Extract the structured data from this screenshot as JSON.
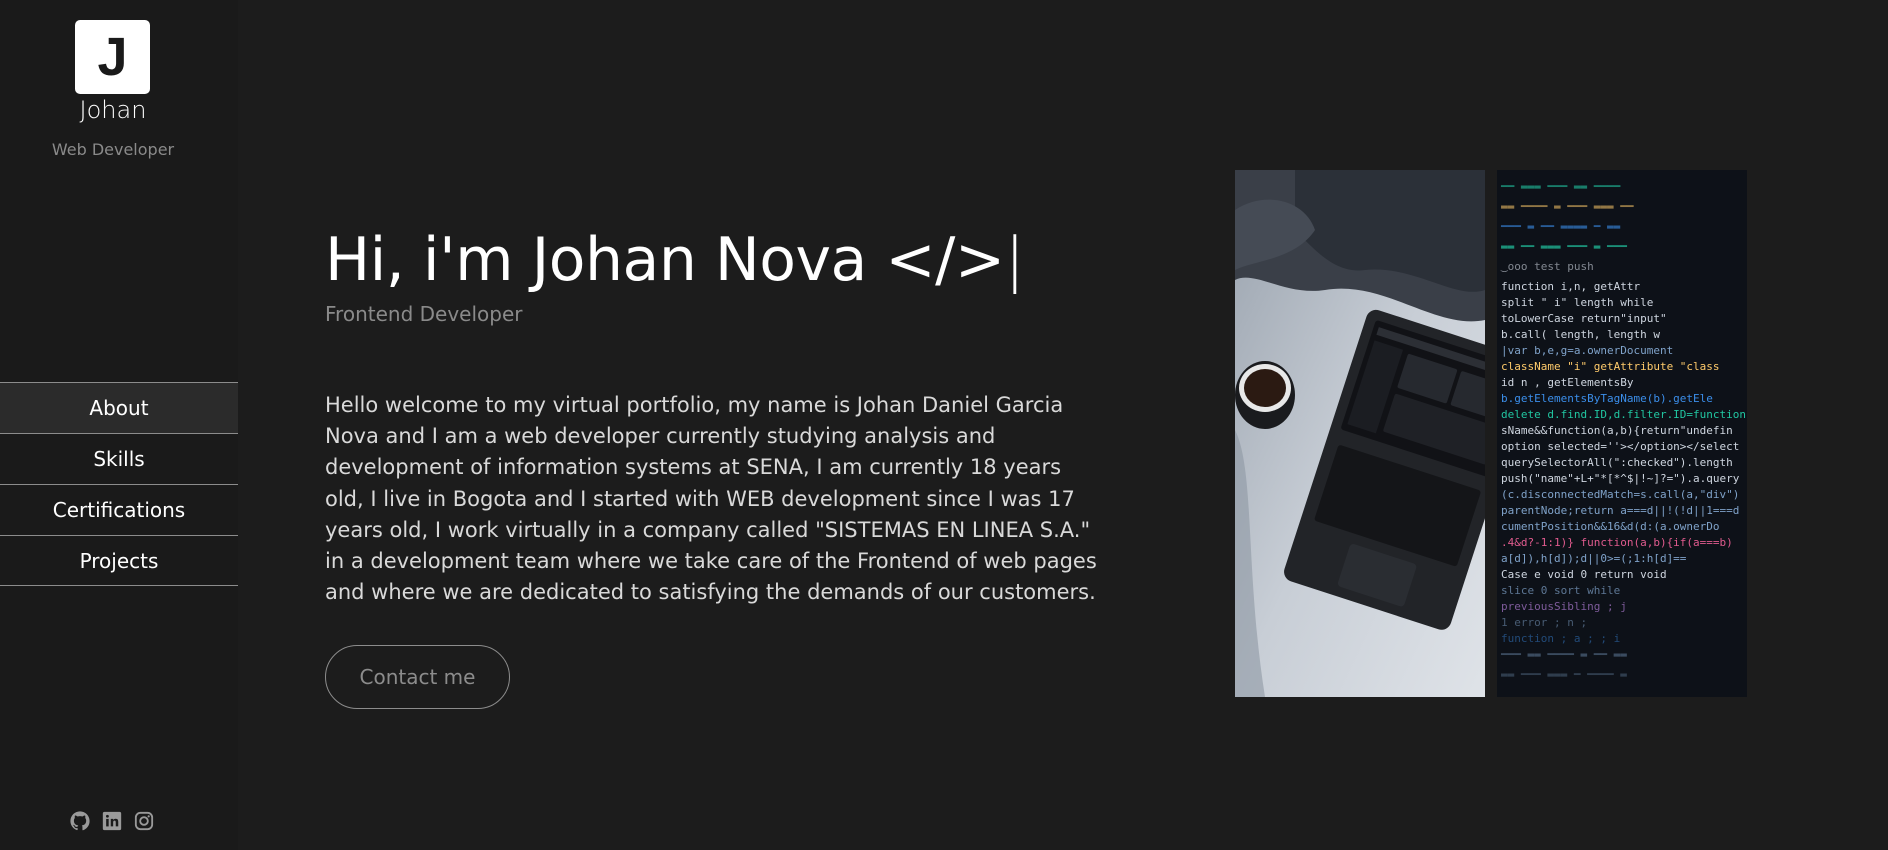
{
  "sidebar": {
    "logo_letter": "J",
    "name": "Johan",
    "role": "Web Developer",
    "nav": [
      {
        "label": "About",
        "active": true
      },
      {
        "label": "Skills",
        "active": false
      },
      {
        "label": "Certifications",
        "active": false
      },
      {
        "label": "Projects",
        "active": false
      }
    ],
    "socials": [
      {
        "icon": "github-icon"
      },
      {
        "icon": "linkedin-icon"
      },
      {
        "icon": "instagram-icon"
      }
    ]
  },
  "hero": {
    "title": "Hi, i'm Johan Nova </>",
    "cursor": "|",
    "subtitle": "Frontend Developer",
    "bio": "Hello welcome to my virtual portfolio, my name is Johan Daniel Garcia Nova and I am a web developer currently studying analysis and development of information systems at SENA, I am currently 18 years old, I live in Bogota and I started with WEB development since I was 17 years old, I work virtually in a company called \"SISTEMAS EN LINEA S.A.\" in a development team where we take care of the Frontend of web pages and where we are dedicated to satisfying the demands of our customers.",
    "contact_label": "Contact me"
  },
  "images": [
    {
      "name": "laptop-photo",
      "subject": "laptop with coffee cup on bed"
    },
    {
      "name": "code-photo",
      "subject": "colorful source code on dark screen"
    }
  ],
  "colors": {
    "background": "#1c1c1c",
    "sidebar": "#1a1a1a",
    "nav_active": "#2b2b2b",
    "muted_text": "#8a8a8a",
    "divider": "#8c8c8c"
  }
}
